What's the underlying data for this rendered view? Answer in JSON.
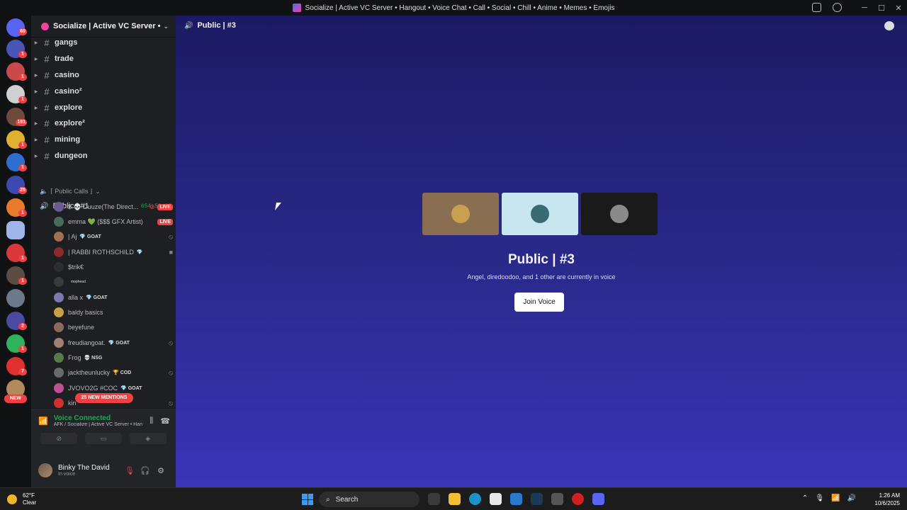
{
  "window": {
    "title": "Socialize | Active VC Server • Hangout • Voice Chat • Call • Social • Chill • Anime • Memes • Emojis"
  },
  "rail": {
    "badges": [
      "60",
      "1",
      "1",
      "1",
      "1",
      "191",
      "1",
      "1",
      "25",
      "1",
      "1",
      "1",
      "1",
      "2",
      "1",
      "1",
      "7"
    ],
    "new_label": "NEW"
  },
  "guild": {
    "name": "Socialize | Active VC Server • ..."
  },
  "text_channels": [
    "gangs",
    "trade",
    "casino",
    "casino²",
    "explore",
    "explore²",
    "mining",
    "dungeon"
  ],
  "voice_category": "⌈ Public Calls ⌋",
  "voice_channel": {
    "name": "Public | #1",
    "timer": "654:56:39"
  },
  "members": [
    {
      "name": "$ 💀 Duuze(The Direct...",
      "tag": "",
      "status": "live"
    },
    {
      "name": "emma 💚 ($$$ GFX Artist)",
      "tag": "",
      "status": "live"
    },
    {
      "name": "| Aj",
      "tag": "💎 GOAT",
      "status": "muted"
    },
    {
      "name": "| RABBI ROTHSCHILD",
      "tag": "💎",
      "status": "video"
    },
    {
      "name": "$trik€",
      "tag": "",
      "status": ""
    },
    {
      "name": "",
      "tag": "mophead",
      "status": ""
    },
    {
      "name": "alla x",
      "tag": "💎 GOAT",
      "status": ""
    },
    {
      "name": "baldy basics",
      "tag": "",
      "status": ""
    },
    {
      "name": "beyefune",
      "tag": "",
      "status": ""
    },
    {
      "name": "freudiangoat.",
      "tag": "💎 GOAT",
      "status": "muted"
    },
    {
      "name": "Frog",
      "tag": "💀 NSG",
      "status": ""
    },
    {
      "name": "jacktheunlucky",
      "tag": "🏆 COD",
      "status": "muted"
    },
    {
      "name": "JVOVO2G #COC",
      "tag": "💎 GOAT",
      "status": ""
    },
    {
      "name": "kin",
      "tag": "",
      "status": "muted"
    }
  ],
  "mentions": "25 NEW MENTIONS",
  "voice_panel": {
    "status": "Voice Connected",
    "location": "AFK / Socialize | Active VC Server • Han..."
  },
  "user": {
    "name": "Binky The David",
    "status": "In voice"
  },
  "main": {
    "channel": "Public | #3",
    "title": "Public | #3",
    "description": "Angel, diredoodoo, and 1 other are currently in voice",
    "join_label": "Join Voice"
  },
  "taskbar": {
    "temp": "62°F",
    "weather": "Clear",
    "search": "Search",
    "time": "1:26 AM",
    "date": "10/6/2025"
  },
  "colors": {
    "green": "#23a55a",
    "red": "#f23f43",
    "main_bg_top": "#1c1a63",
    "main_bg_bottom": "#3a35b8"
  }
}
